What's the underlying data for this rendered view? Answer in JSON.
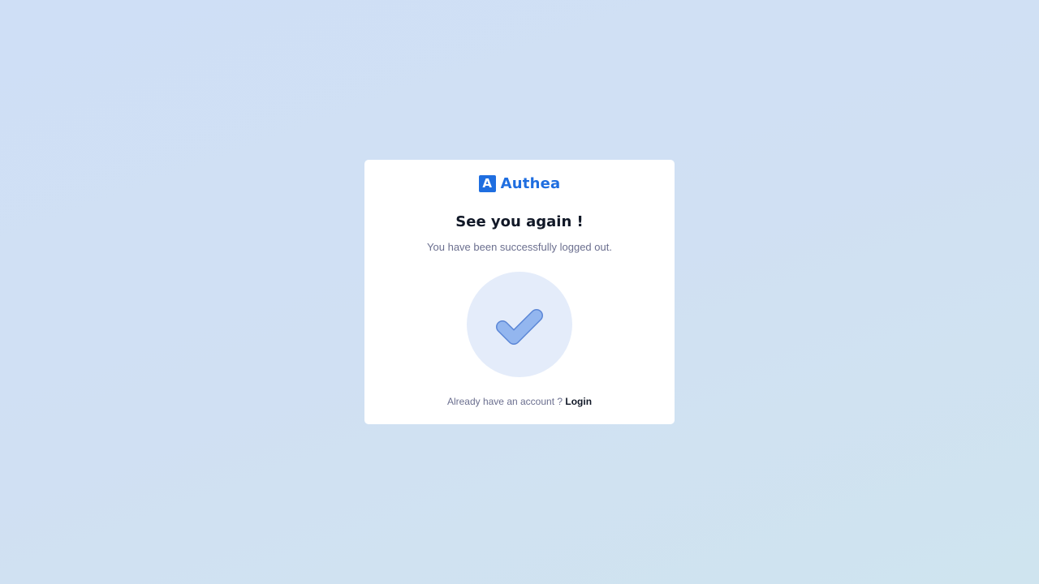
{
  "brand": {
    "mark": "A",
    "name": "Authea",
    "color": "#1f6ee0"
  },
  "logout": {
    "title": "See you again !",
    "message": "You have been successfully logged out.",
    "success_icon": "check-icon"
  },
  "footer": {
    "prompt": "Already have an account ?",
    "login_label": "Login"
  }
}
